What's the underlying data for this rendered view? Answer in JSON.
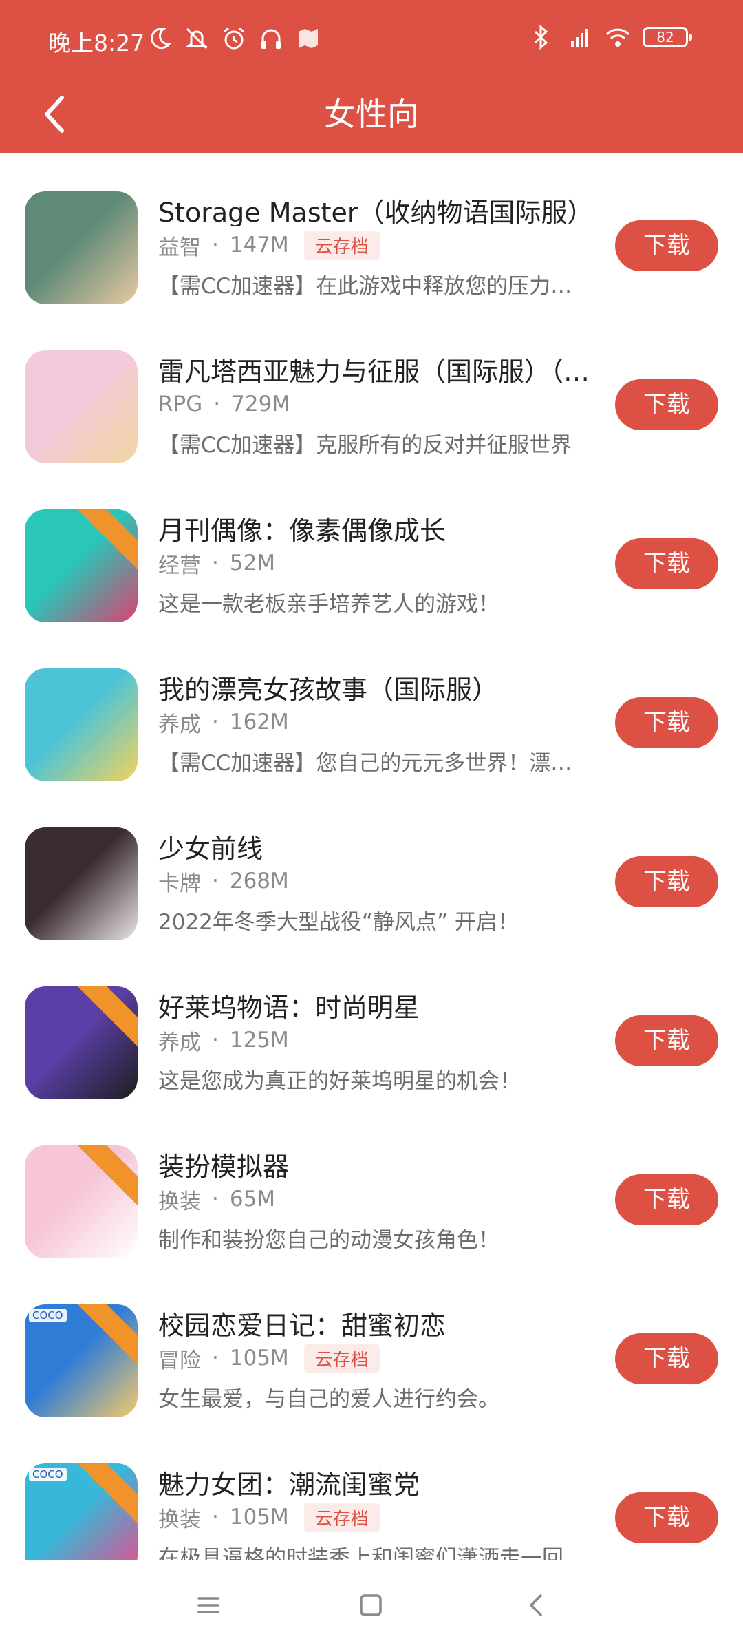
{
  "status_bar": {
    "time": "晚上8:27",
    "battery": "82",
    "icons_left": [
      "moon-icon",
      "bell-off-icon",
      "alarm-icon",
      "headphones-icon",
      "map-icon"
    ],
    "icons_right": [
      "bluetooth-icon",
      "signal-hd-icon",
      "wifi-icon",
      "battery-icon"
    ]
  },
  "header": {
    "title": "女性向",
    "back_icon": "chevron-left-icon"
  },
  "theme": {
    "accent": "#dc5144",
    "badge_bg": "#fbecea",
    "ribbon": "#f0932b"
  },
  "download_label": "下载",
  "cloud_save_label": "云存档",
  "apps": [
    {
      "title": "Storage Master（收纳物语国际服）",
      "category": "益智",
      "size": "147M",
      "cloud_save": true,
      "description": "【需CC加速器】在此游戏中释放您的压力，享受整理的乐趣",
      "free": false,
      "coco": false,
      "icon_colors": [
        "#5f8a78",
        "#e8c9a0"
      ]
    },
    {
      "title": "雷凡塔西亚魅力与征服（国际服）（需CC加速器）",
      "category": "RPG",
      "size": "729M",
      "cloud_save": false,
      "description": "【需CC加速器】克服所有的反对并征服世界",
      "free": false,
      "coco": false,
      "icon_colors": [
        "#f3c9dc",
        "#f2d6a1"
      ]
    },
    {
      "title": "月刊偶像：像素偶像成长",
      "category": "经营",
      "size": "52M",
      "cloud_save": false,
      "description": "这是一款老板亲手培养艺人的游戏！",
      "free": true,
      "coco": false,
      "icon_colors": [
        "#2ac6b8",
        "#d8426f"
      ]
    },
    {
      "title": "我的漂亮女孩故事（国际服）",
      "category": "养成",
      "size": "162M",
      "cloud_save": false,
      "description": "【需CC加速器】您自己的元元多世界！漂亮女孩",
      "free": false,
      "coco": false,
      "icon_colors": [
        "#4cc4d6",
        "#f4d25c"
      ]
    },
    {
      "title": "少女前线",
      "category": "卡牌",
      "size": "268M",
      "cloud_save": false,
      "description": "2022年冬季大型战役“静风点” 开启！",
      "free": false,
      "coco": false,
      "icon_colors": [
        "#3a2c33",
        "#e9e4e6"
      ]
    },
    {
      "title": "好莱坞物语：时尚明星",
      "category": "养成",
      "size": "125M",
      "cloud_save": false,
      "description": "这是您成为真正的好莱坞明星的机会！",
      "free": true,
      "coco": false,
      "icon_colors": [
        "#5a3fa6",
        "#1e1e1e"
      ]
    },
    {
      "title": "装扮模拟器",
      "category": "换装",
      "size": "65M",
      "cloud_save": false,
      "description": "制作和装扮您自己的动漫女孩角色！",
      "free": true,
      "coco": false,
      "icon_colors": [
        "#f6c6d8",
        "#ffffff"
      ]
    },
    {
      "title": "校园恋爱日记：甜蜜初恋",
      "category": "冒险",
      "size": "105M",
      "cloud_save": true,
      "description": "女生最爱，与自己的爱人进行约会。",
      "free": true,
      "coco": true,
      "icon_colors": [
        "#2f7dd6",
        "#f5c96a"
      ]
    },
    {
      "title": "魅力女团：潮流闺蜜党",
      "category": "换装",
      "size": "105M",
      "cloud_save": true,
      "description": "在极具逼格的时装秀上和闺蜜们潇洒走一回",
      "free": true,
      "coco": true,
      "icon_colors": [
        "#37b7d9",
        "#e84d8a"
      ]
    }
  ]
}
